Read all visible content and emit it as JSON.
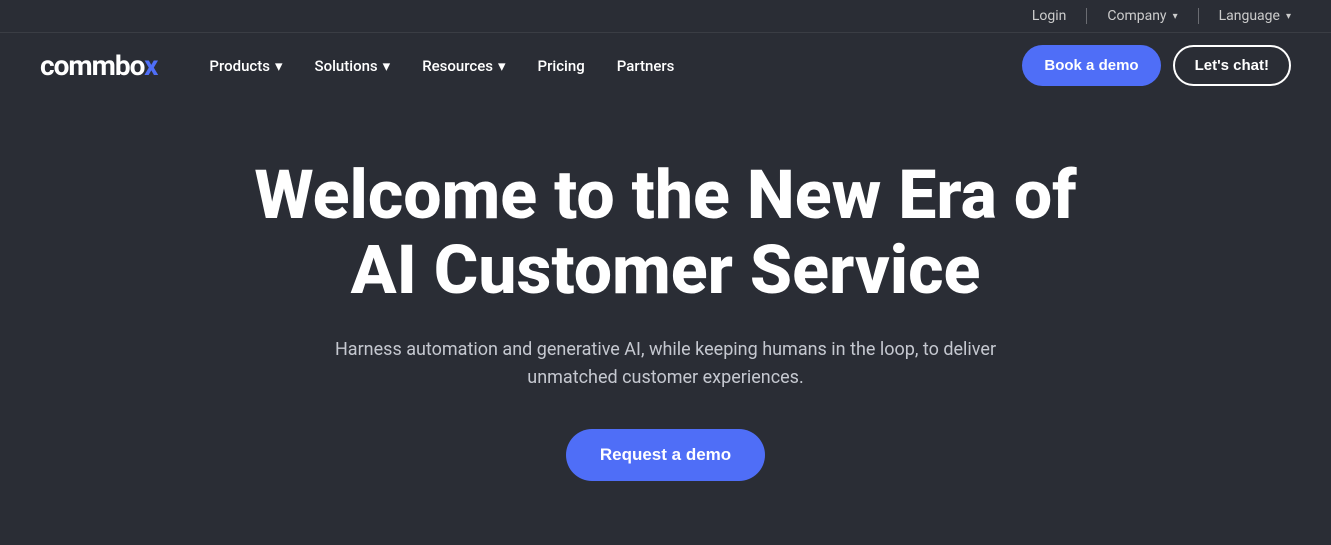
{
  "topbar": {
    "login_label": "Login",
    "company_label": "Company",
    "language_label": "Language"
  },
  "navbar": {
    "logo_text": "commbox",
    "products_label": "Products",
    "solutions_label": "Solutions",
    "resources_label": "Resources",
    "pricing_label": "Pricing",
    "partners_label": "Partners",
    "book_demo_label": "Book a demo",
    "lets_chat_label": "Let's chat!"
  },
  "hero": {
    "title_line1": "Welcome to the New Era of",
    "title_line2": "AI Customer Service",
    "subtitle": "Harness automation and generative AI, while keeping humans in the loop, to deliver unmatched customer experiences.",
    "cta_label": "Request a demo"
  },
  "colors": {
    "accent": "#4f6ef7",
    "background": "#2a2d35",
    "text_primary": "#ffffff",
    "text_secondary": "#c5c8d0"
  }
}
